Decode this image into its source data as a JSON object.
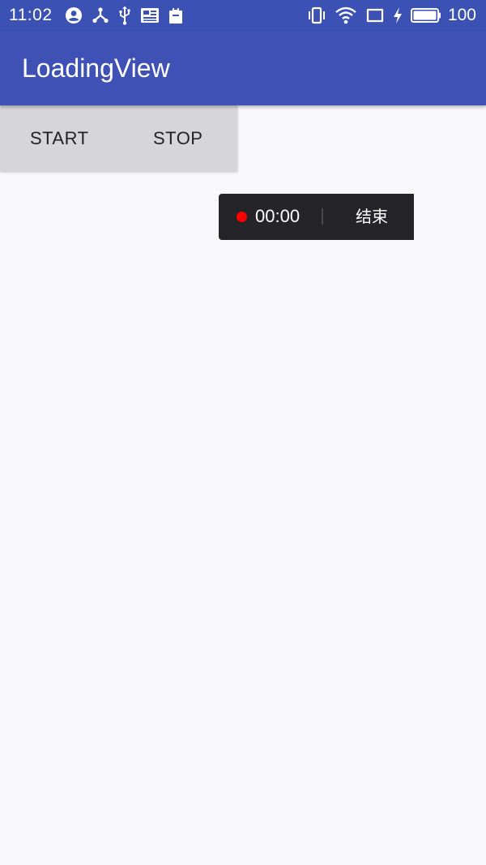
{
  "status_bar": {
    "time": "11:02",
    "battery_level": "100",
    "icons_left": [
      "account-circle-icon",
      "share-network-icon",
      "usb-icon",
      "news-icon",
      "clipboard-icon"
    ],
    "icons_right": [
      "vibrate-icon",
      "wifi-icon",
      "tablet-icon",
      "charging-bolt-icon",
      "battery-icon"
    ],
    "bg_color": "#3c51b4"
  },
  "app_bar": {
    "title": "LoadingView",
    "bg_color": "#3f51b5"
  },
  "buttons": {
    "start_label": "START",
    "stop_label": "STOP"
  },
  "screen_record": {
    "elapsed": "00:00",
    "end_label": "结束",
    "indicator_color": "#ff0000"
  }
}
